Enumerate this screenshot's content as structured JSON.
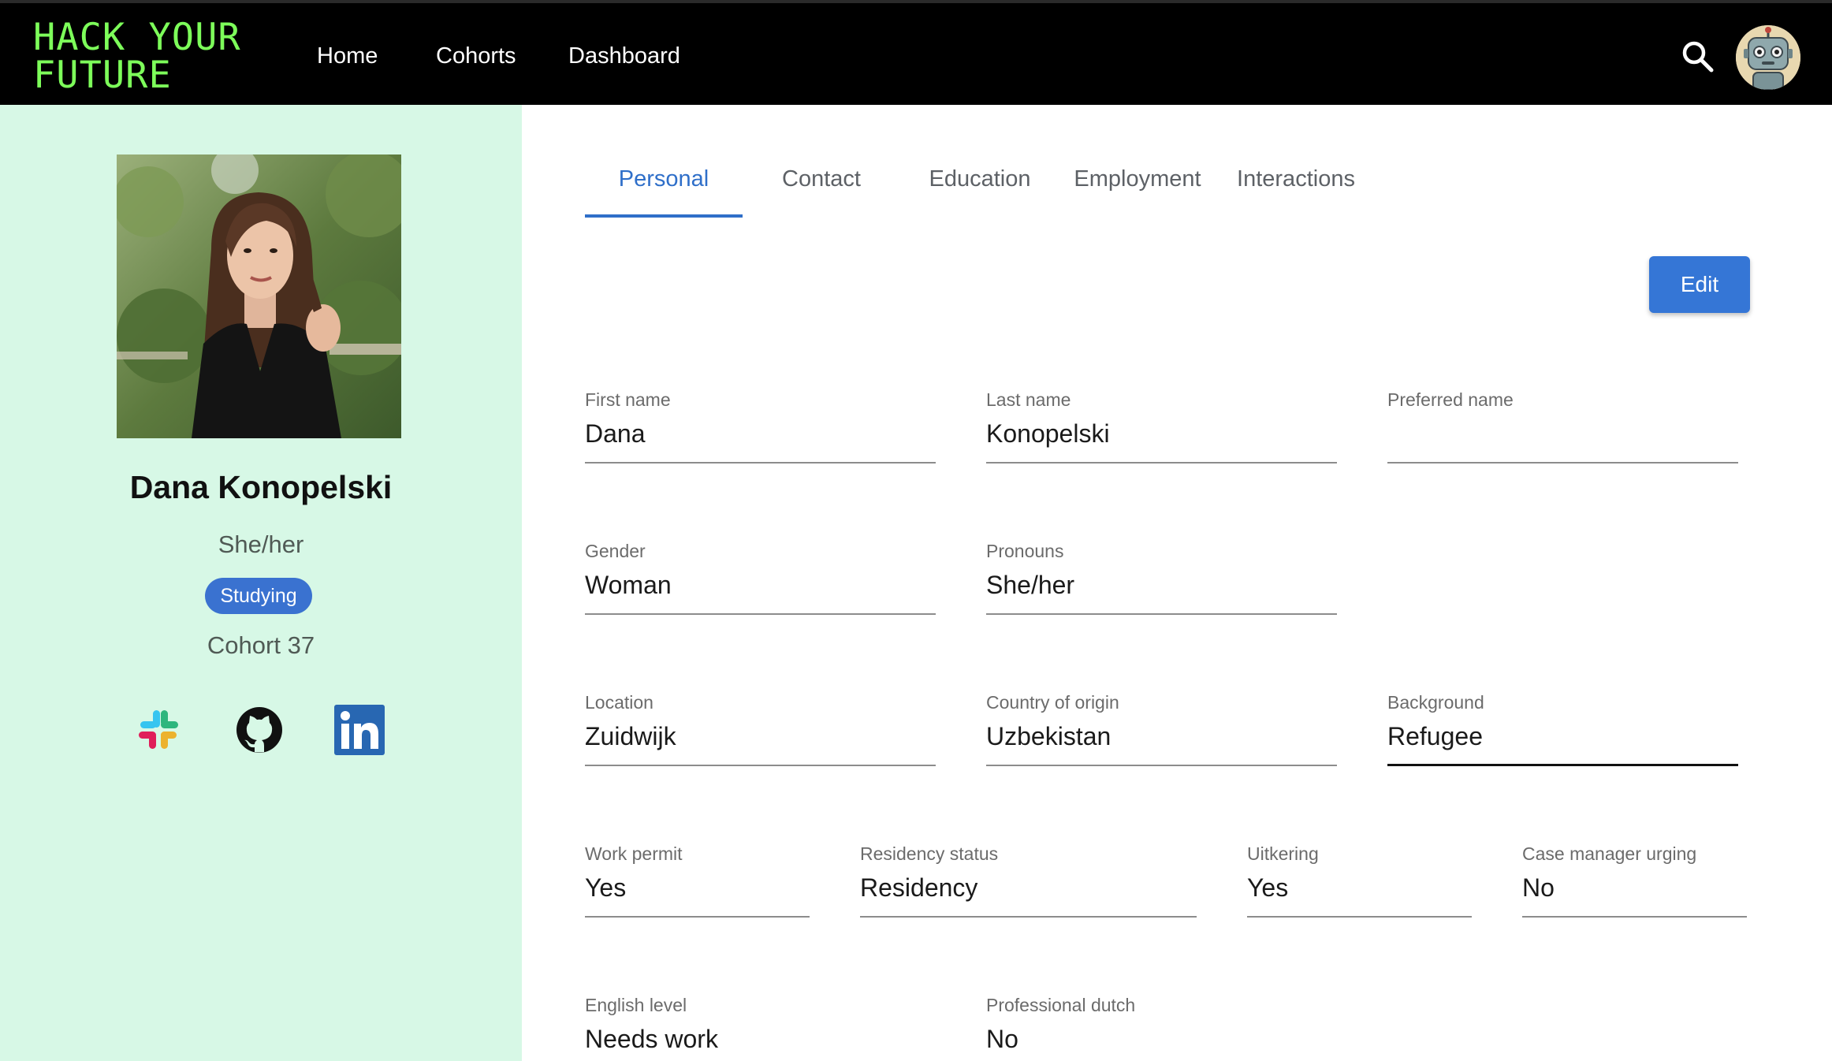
{
  "header": {
    "logo_line1": "HACK YOUR",
    "logo_line2": "FUTURE",
    "nav": [
      "Home",
      "Cohorts",
      "Dashboard"
    ],
    "search_icon": "search-icon",
    "avatar_icon": "robot-avatar-icon"
  },
  "profile": {
    "full_name": "Dana Konopelski",
    "pronouns": "She/her",
    "status": "Studying",
    "cohort": "Cohort 37",
    "social_icons": [
      "slack-icon",
      "github-icon",
      "linkedin-icon"
    ]
  },
  "tabs": {
    "active": "Personal",
    "items": [
      "Personal",
      "Contact",
      "Education",
      "Employment",
      "Interactions"
    ]
  },
  "actions": {
    "edit_label": "Edit"
  },
  "form": {
    "first_name": {
      "label": "First name",
      "value": "Dana"
    },
    "last_name": {
      "label": "Last name",
      "value": "Konopelski"
    },
    "preferred_name": {
      "label": "Preferred name",
      "value": ""
    },
    "gender": {
      "label": "Gender",
      "value": "Woman"
    },
    "pronouns": {
      "label": "Pronouns",
      "value": "She/her"
    },
    "location": {
      "label": "Location",
      "value": "Zuidwijk"
    },
    "country_of_origin": {
      "label": "Country of origin",
      "value": "Uzbekistan"
    },
    "background": {
      "label": "Background",
      "value": "Refugee"
    },
    "work_permit": {
      "label": "Work permit",
      "value": "Yes"
    },
    "residency_status": {
      "label": "Residency status",
      "value": "Residency"
    },
    "uitkering": {
      "label": "Uitkering",
      "value": "Yes"
    },
    "case_manager_urging": {
      "label": "Case manager urging",
      "value": "No"
    },
    "english_level": {
      "label": "English level",
      "value": "Needs work"
    },
    "professional_dutch": {
      "label": "Professional dutch",
      "value": "No"
    }
  },
  "colors": {
    "accent": "#2f6fc9",
    "logo": "#7dff5a",
    "sidebar_bg": "#d7f8e6",
    "status_badge": "#3a72d0"
  }
}
